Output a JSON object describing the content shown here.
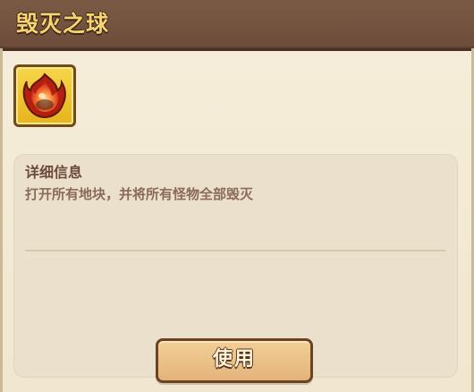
{
  "dialog": {
    "title": "毁灭之球"
  },
  "item": {
    "icon": "fireball-icon"
  },
  "details": {
    "heading": "详细信息",
    "description": "打开所有地块，并将所有怪物全部毁灭"
  },
  "actions": {
    "use_label": "使用"
  },
  "colors": {
    "title_bar": "#6d4c3a",
    "title_text": "#f6d470",
    "panel_bg": "#ebe0cb",
    "button_bg": "#e3b47a",
    "item_frame": "#e6b41d"
  }
}
